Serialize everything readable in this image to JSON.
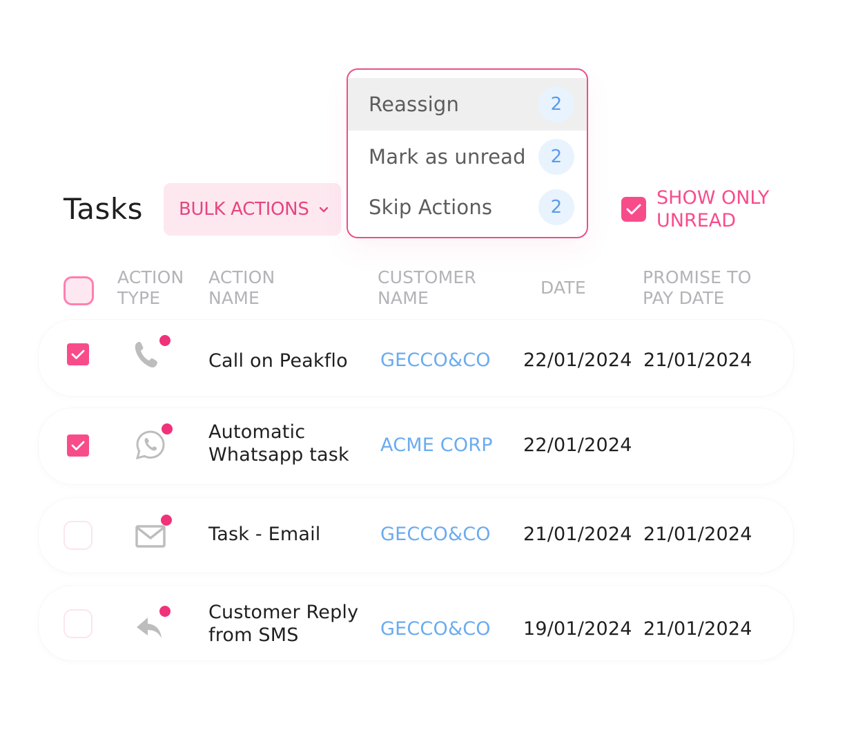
{
  "header": {
    "title": "Tasks",
    "bulk_actions_label": "BULK ACTIONS",
    "show_only_unread_label": "SHOW ONLY UNREAD",
    "show_only_unread_checked": true
  },
  "bulk_menu": {
    "items": [
      {
        "label": "Reassign",
        "count": "2",
        "highlighted": true
      },
      {
        "label": "Mark as unread",
        "count": "2",
        "highlighted": false
      },
      {
        "label": "Skip Actions",
        "count": "2",
        "highlighted": false
      }
    ]
  },
  "table": {
    "columns": [
      "ACTION TYPE",
      "ACTION NAME",
      "CUSTOMER NAME",
      "DATE",
      "PROMISE TO PAY DATE"
    ],
    "rows": [
      {
        "checked": true,
        "action_type": "phone-icon",
        "unread": true,
        "action_name": "Call on Peakflo",
        "customer": "GECCO&CO",
        "date": "22/01/2024",
        "promise_date": "21/01/2024"
      },
      {
        "checked": true,
        "action_type": "whatsapp-icon",
        "unread": true,
        "action_name": "Automatic Whatsapp task",
        "customer": "ACME CORP",
        "date": "22/01/2024",
        "promise_date": ""
      },
      {
        "checked": false,
        "action_type": "email-icon",
        "unread": true,
        "action_name": "Task - Email",
        "customer": "GECCO&CO",
        "date": "21/01/2024",
        "promise_date": "21/01/2024"
      },
      {
        "checked": false,
        "action_type": "reply-icon",
        "unread": true,
        "action_name": "Customer Reply from SMS",
        "customer": "GECCO&CO",
        "date": "19/01/2024",
        "promise_date": "21/01/2024"
      }
    ]
  },
  "colors": {
    "accent_pink": "#f84c8a",
    "customer_link": "#6aabf0",
    "badge_bg": "#e8f3fe",
    "badge_text": "#5b9be9",
    "header_text": "#b3b3b8",
    "unread_dot": "#f0327a"
  }
}
